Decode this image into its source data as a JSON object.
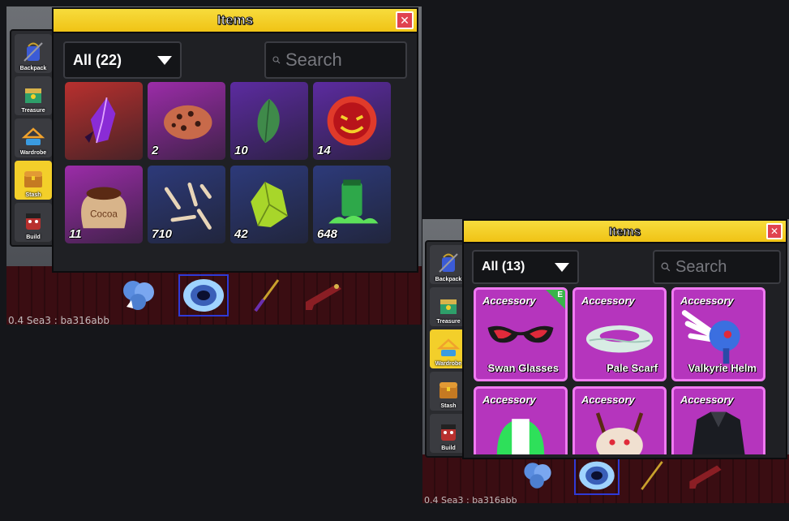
{
  "left": {
    "window_title": "Items",
    "close_label": "✕",
    "filter_label": "All (22)",
    "search_placeholder": "Search",
    "sidebar": [
      {
        "label": "Backpack",
        "icon": "backpack-icon",
        "active": false
      },
      {
        "label": "Treasure",
        "icon": "treasure-icon",
        "active": false
      },
      {
        "label": "Wardrobe",
        "icon": "wardrobe-icon",
        "active": false
      },
      {
        "label": "Stash",
        "icon": "stash-icon",
        "active": true
      },
      {
        "label": "Build",
        "icon": "build-icon",
        "active": false
      }
    ],
    "items": [
      {
        "icon": "purple-crystal-icon",
        "count": "",
        "bg": "#b8302e"
      },
      {
        "icon": "meteorite-icon",
        "count": "2",
        "bg": "#9b2ca8"
      },
      {
        "icon": "green-leaf-icon",
        "count": "10",
        "bg": "#5c2ba0"
      },
      {
        "icon": "demonic-wisp-icon",
        "count": "14",
        "bg": "#5c2ba0"
      },
      {
        "icon": "cocoa-sack-icon",
        "count": "11",
        "bg": "#9b2ca8"
      },
      {
        "icon": "bones-icon",
        "count": "710",
        "bg": "#2d3a7a"
      },
      {
        "icon": "green-gem-icon",
        "count": "42",
        "bg": "#2d3a7a"
      },
      {
        "icon": "ectoplasm-icon",
        "count": "648",
        "bg": "#2d3a7a"
      }
    ],
    "version": "0.4 Sea3 : ba316abb"
  },
  "right": {
    "window_title": "Items",
    "close_label": "✕",
    "filter_label": "All (13)",
    "search_placeholder": "Search",
    "sidebar": [
      {
        "label": "Backpack",
        "icon": "backpack-icon",
        "active": false
      },
      {
        "label": "Treasure",
        "icon": "treasure-icon",
        "active": false
      },
      {
        "label": "Wardrobe",
        "icon": "wardrobe-icon",
        "active": true
      },
      {
        "label": "Stash",
        "icon": "stash-icon",
        "active": false
      },
      {
        "label": "Build",
        "icon": "build-icon",
        "active": false
      }
    ],
    "accessories": [
      {
        "type": "Accessory",
        "name": "Swan Glasses",
        "equipped": true,
        "equip_label": "E",
        "icon": "swan-glasses-icon"
      },
      {
        "type": "Accessory",
        "name": "Pale Scarf",
        "equipped": false,
        "icon": "pale-scarf-icon"
      },
      {
        "type": "Accessory",
        "name": "Valkyrie Helm",
        "equipped": false,
        "icon": "valkyrie-helm-icon"
      },
      {
        "type": "Accessory",
        "name": "",
        "equipped": false,
        "icon": "green-helmet-icon"
      },
      {
        "type": "Accessory",
        "name": "",
        "equipped": false,
        "icon": "horned-mask-icon"
      },
      {
        "type": "Accessory",
        "name": "",
        "equipped": false,
        "icon": "dark-cape-icon"
      }
    ],
    "version": "0.4 Sea3 : ba316abb"
  }
}
